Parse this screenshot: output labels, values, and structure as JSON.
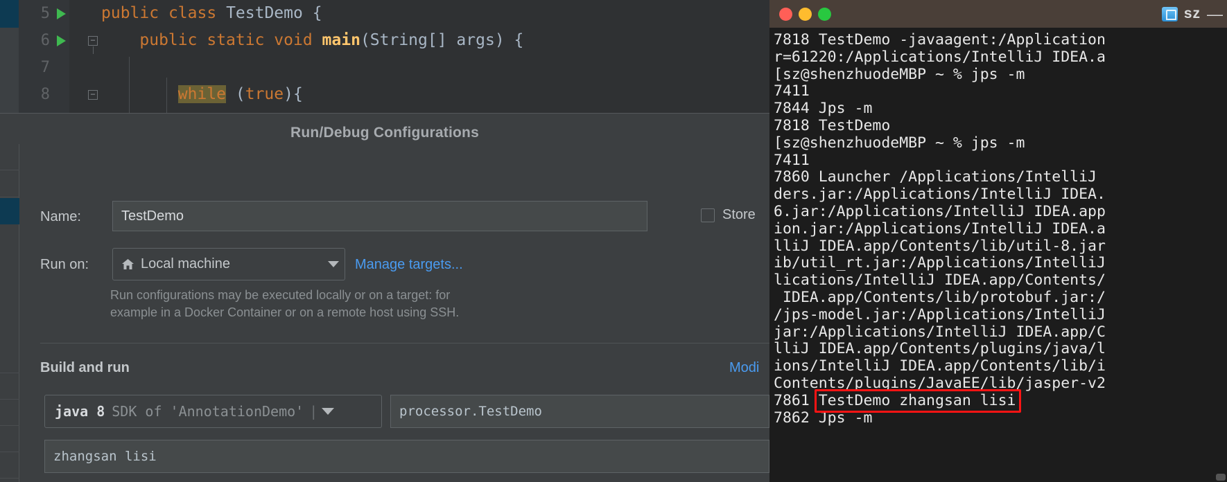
{
  "editor": {
    "lines": [
      {
        "number": "5",
        "hasRunArrow": true,
        "tokens": [
          {
            "t": "public",
            "c": "kw"
          },
          {
            "t": " ",
            "c": "pun"
          },
          {
            "t": "class",
            "c": "kw"
          },
          {
            "t": " ",
            "c": "pun"
          },
          {
            "t": "TestDemo",
            "c": "cls"
          },
          {
            "t": " ",
            "c": "pun"
          },
          {
            "t": "{",
            "c": "pun"
          }
        ]
      },
      {
        "number": "6",
        "hasRunArrow": true,
        "tokens": [
          {
            "t": "    ",
            "c": "pun"
          },
          {
            "t": "public",
            "c": "kw"
          },
          {
            "t": " ",
            "c": "pun"
          },
          {
            "t": "static",
            "c": "kw"
          },
          {
            "t": " ",
            "c": "pun"
          },
          {
            "t": "void",
            "c": "kw"
          },
          {
            "t": " ",
            "c": "pun"
          },
          {
            "t": "main",
            "c": "mth"
          },
          {
            "t": "(",
            "c": "pun"
          },
          {
            "t": "String[] args",
            "c": "cls"
          },
          {
            "t": ") {",
            "c": "pun"
          }
        ]
      },
      {
        "number": "7",
        "hasRunArrow": false,
        "tokens": []
      },
      {
        "number": "8",
        "hasRunArrow": false,
        "tokens": [
          {
            "t": "        ",
            "c": "pun"
          },
          {
            "t": "while",
            "c": "hl-while"
          },
          {
            "t": " (",
            "c": "pun"
          },
          {
            "t": "true",
            "c": "lit"
          },
          {
            "t": "){",
            "c": "pun"
          }
        ]
      }
    ]
  },
  "dialog": {
    "title": "Run/Debug Configurations",
    "name_label": "Name:",
    "name_value": "TestDemo",
    "store_checkbox_label": "Store",
    "store_checked": false,
    "run_on_label": "Run on:",
    "run_on_value": "Local machine",
    "run_on_icon": "home-icon",
    "manage_targets_link": "Manage targets...",
    "hint_line1": "Run configurations may be executed locally or on a target: for",
    "hint_line2": "example in a Docker Container or on a remote host using SSH.",
    "build_and_run_title": "Build and run",
    "modify_link": "Modi",
    "sdk_main": "java 8",
    "sdk_sub": "SDK of 'AnnotationDemo'",
    "sdk_sep": "|",
    "main_class_value": "processor.TestDemo",
    "program_args_value": "zhangsan lisi",
    "accent_link_color": "#4a9bf0",
    "selected_sidebar_color": "#0d3a52"
  },
  "terminal": {
    "title": "sz",
    "minimize_glyph": "—",
    "folder_icon": "folder-icon",
    "lines": [
      "7818 TestDemo -javaagent:/Application",
      "r=61220:/Applications/IntelliJ IDEA.a",
      "[sz@shenzhuodeMBP ~ % jps -m",
      "7411",
      "7844 Jps -m",
      "7818 TestDemo",
      "[sz@shenzhuodeMBP ~ % jps -m",
      "7411",
      "7860 Launcher /Applications/IntelliJ",
      "ders.jar:/Applications/IntelliJ IDEA.",
      "6.jar:/Applications/IntelliJ IDEA.app",
      "ion.jar:/Applications/IntelliJ IDEA.a",
      "lliJ IDEA.app/Contents/lib/util-8.jar",
      "ib/util_rt.jar:/Applications/IntelliJ",
      "lications/IntelliJ IDEA.app/Contents/",
      " IDEA.app/Contents/lib/protobuf.jar:/",
      "/jps-model.jar:/Applications/IntelliJ",
      "jar:/Applications/IntelliJ IDEA.app/C",
      "lliJ IDEA.app/Contents/plugins/java/l",
      "ions/IntelliJ IDEA.app/Contents/lib/i",
      "Contents/plugins/JavaEE/lib/jasper-v2",
      "7861 TestDemo zhangsan lisi",
      "7862 Jps -m"
    ],
    "highlight": {
      "text": "TestDemo zhangsan lisi",
      "color": "#ff1414"
    }
  }
}
